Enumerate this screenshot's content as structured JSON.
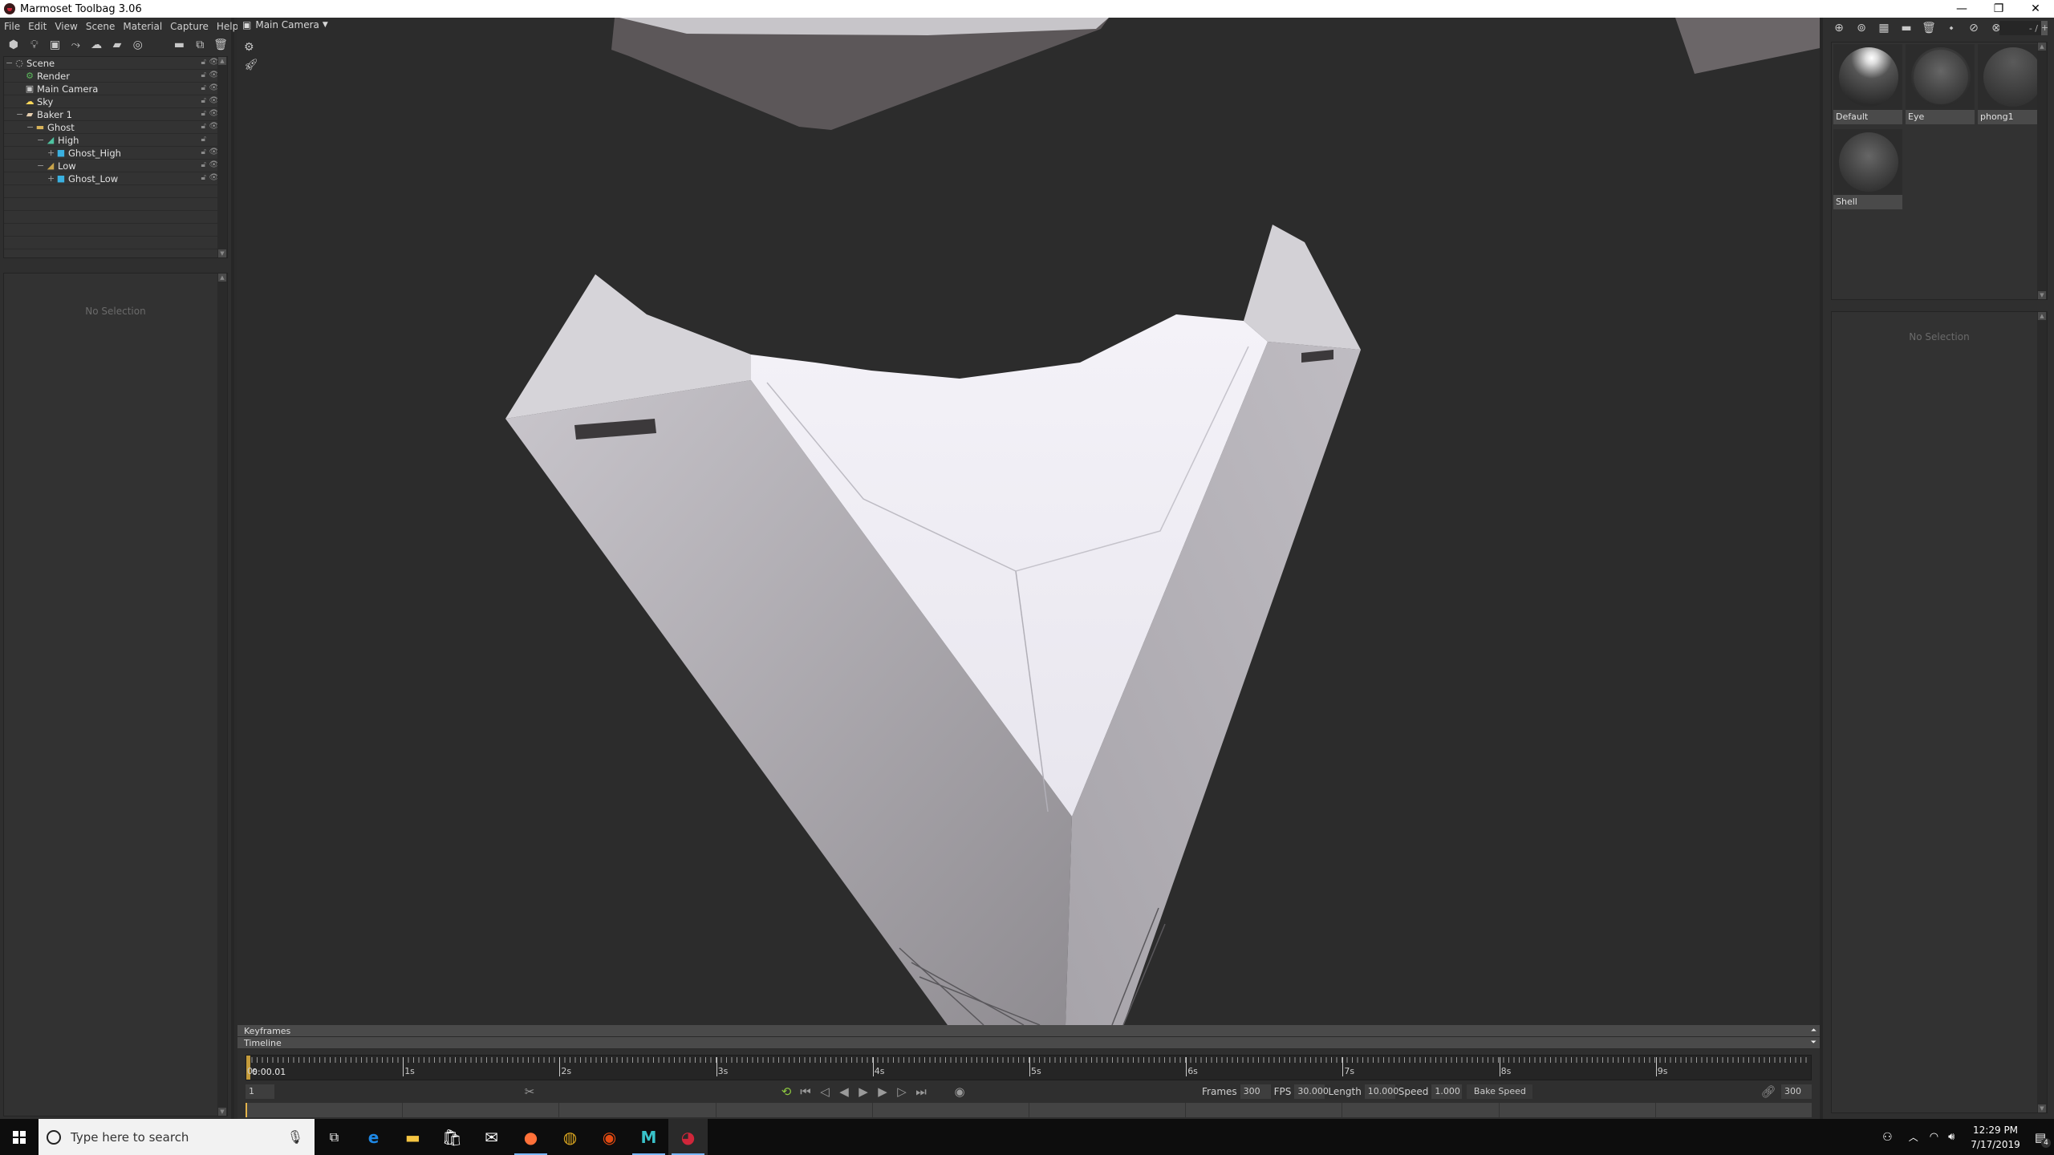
{
  "window": {
    "title": "Marmoset Toolbag 3.06",
    "controls": {
      "minimize": "—",
      "maximize": "❐",
      "close": "✕"
    }
  },
  "menu": [
    "File",
    "Edit",
    "View",
    "Scene",
    "Material",
    "Capture",
    "Help"
  ],
  "left_toolbar": {
    "icons": [
      "add-mesh-icon",
      "add-light-icon",
      "add-camera-icon",
      "add-shadow-catcher-icon",
      "add-sky-icon",
      "add-baker-icon",
      "add-turntable-icon"
    ],
    "actions": [
      "new-folder-icon",
      "duplicate-icon",
      "delete-icon"
    ]
  },
  "scene_tree": [
    {
      "label": "Scene",
      "icon": "scene-icon",
      "depth": 0,
      "expander": "−",
      "visible": true
    },
    {
      "label": "Render",
      "icon": "render-gear-icon",
      "depth": 1,
      "expander": "",
      "visible": true
    },
    {
      "label": "Main Camera",
      "icon": "camera-icon",
      "depth": 1,
      "expander": "",
      "visible": true
    },
    {
      "label": "Sky",
      "icon": "sky-icon",
      "depth": 1,
      "expander": "",
      "visible": true
    },
    {
      "label": "Baker 1",
      "icon": "baker-icon",
      "depth": 1,
      "expander": "−",
      "visible": true
    },
    {
      "label": "Ghost",
      "icon": "folder-icon",
      "depth": 2,
      "expander": "−",
      "visible": true
    },
    {
      "label": "High",
      "icon": "high-group-icon",
      "depth": 3,
      "expander": "−",
      "visible": false
    },
    {
      "label": "Ghost_High",
      "icon": "mesh-icon",
      "depth": 4,
      "expander": "+",
      "visible": true
    },
    {
      "label": "Low",
      "icon": "low-group-icon",
      "depth": 3,
      "expander": "−",
      "visible": true
    },
    {
      "label": "Ghost_Low",
      "icon": "mesh-icon",
      "depth": 4,
      "expander": "+",
      "visible": true
    }
  ],
  "left_properties": {
    "empty_text": "No Selection"
  },
  "viewport": {
    "camera_label": "Main Camera",
    "tools": [
      "settings-gear-icon",
      "rocket-icon"
    ]
  },
  "right_toolbar": {
    "icons": [
      "new-material-icon",
      "duplicate-material-icon",
      "checker-icon",
      "open-folder-icon",
      "delete-icon",
      "assign-material-icon",
      "import-material-icon",
      "export-material-icon"
    ],
    "pager": "- /",
    "pager_add": "+"
  },
  "materials": [
    {
      "name": "Default"
    },
    {
      "name": "Eye"
    },
    {
      "name": "phong1"
    },
    {
      "name": "Shell"
    }
  ],
  "right_properties": {
    "empty_text": "No Selection"
  },
  "timeline": {
    "keyframes_label": "Keyframes",
    "timeline_label": "Timeline",
    "seconds": [
      "0s",
      "1s",
      "2s",
      "3s",
      "4s",
      "5s",
      "6s",
      "7s",
      "8s",
      "9s"
    ],
    "current_time": "0:00.01",
    "current_frame": "1",
    "frames_label": "Frames",
    "frames": "300",
    "fps_label": "FPS",
    "fps": "30.000",
    "length_label": "Length",
    "length": "10.000",
    "speed_label": "Speed",
    "speed": "1.000",
    "bake_speed_label": "Bake Speed",
    "end_frame": "300",
    "playhead_fraction": 0.0
  },
  "taskbar": {
    "search_placeholder": "Type here to search",
    "apps": [
      "task-view-icon",
      "edge-icon",
      "file-explorer-icon",
      "store-icon",
      "mail-icon",
      "firefox-icon",
      "ring-app-icon",
      "eye-app-icon",
      "maya-icon",
      "marmoset-icon"
    ],
    "time": "12:29 PM",
    "date": "7/17/2019",
    "notification_count": "4"
  }
}
